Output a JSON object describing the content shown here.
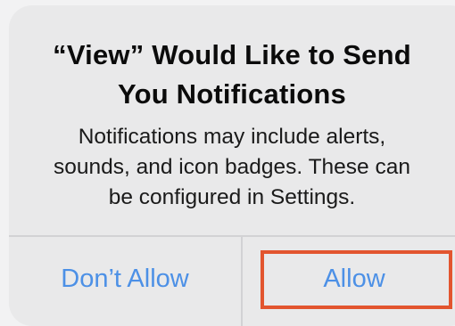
{
  "dialog": {
    "title_line1": "“View” Would Like to Send",
    "title_line2": "You Notifications",
    "message_line1": "Notifications may include alerts,",
    "message_line2": "sounds, and icon badges. These can",
    "message_line3": "be configured in Settings.",
    "buttons": {
      "deny_label": "Don’t Allow",
      "allow_label": "Allow"
    }
  },
  "colors": {
    "background": "#f2f2f3",
    "dialog": "#e9e9ea",
    "button_text": "#4c90e6",
    "highlight": "#e2552f"
  }
}
